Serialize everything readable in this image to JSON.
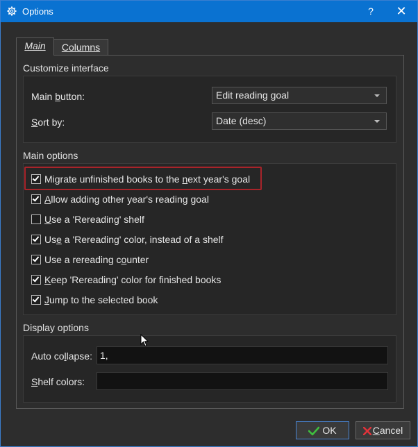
{
  "window": {
    "title": "Options",
    "help_label": "?",
    "close_label": "✕"
  },
  "tabs": [
    {
      "label": "Main",
      "active": true
    },
    {
      "label": "Columns",
      "active": false
    }
  ],
  "customize": {
    "group_label": "Customize interface",
    "main_button_label_pre": "Main ",
    "main_button_label_u": "b",
    "main_button_label_post": "utton:",
    "main_button_value": "Edit reading goal",
    "sort_label_u": "S",
    "sort_label_post": "ort by:",
    "sort_value": "Date (desc)"
  },
  "main_options": {
    "group_label": "Main options",
    "items": [
      {
        "pre": "Migrate unfinished books to the ",
        "u": "n",
        "post": "ext year's goal",
        "checked": true
      },
      {
        "pre": "",
        "u": "A",
        "post": "llow adding other year's reading goal",
        "checked": true
      },
      {
        "pre": "",
        "u": "U",
        "post": "se a 'Rereading' shelf",
        "checked": false
      },
      {
        "pre": "Us",
        "u": "e",
        "post": " a 'Rereading' color, instead of a shelf",
        "checked": true
      },
      {
        "pre": "Use a rereading c",
        "u": "o",
        "post": "unter",
        "checked": true
      },
      {
        "pre": "",
        "u": "K",
        "post": "eep 'Rereading' color for finished books",
        "checked": true
      },
      {
        "pre": "",
        "u": "J",
        "post": "ump to the selected book",
        "checked": true
      }
    ]
  },
  "display": {
    "group_label": "Display options",
    "collapse_label_pre": "Auto co",
    "collapse_label_u": "l",
    "collapse_label_post": "lapse:",
    "collapse_value": "1,",
    "shelf_label_u": "S",
    "shelf_label_post": "helf colors:",
    "shelf_value": ""
  },
  "buttons": {
    "ok_label": "OK",
    "cancel_u": "C",
    "cancel_post": "ancel"
  },
  "colors": {
    "titlebar": "#0a72d1",
    "focus_ring": "#a8242a",
    "ok_check": "#3fbf3f",
    "cancel_x": "#e0333a"
  }
}
